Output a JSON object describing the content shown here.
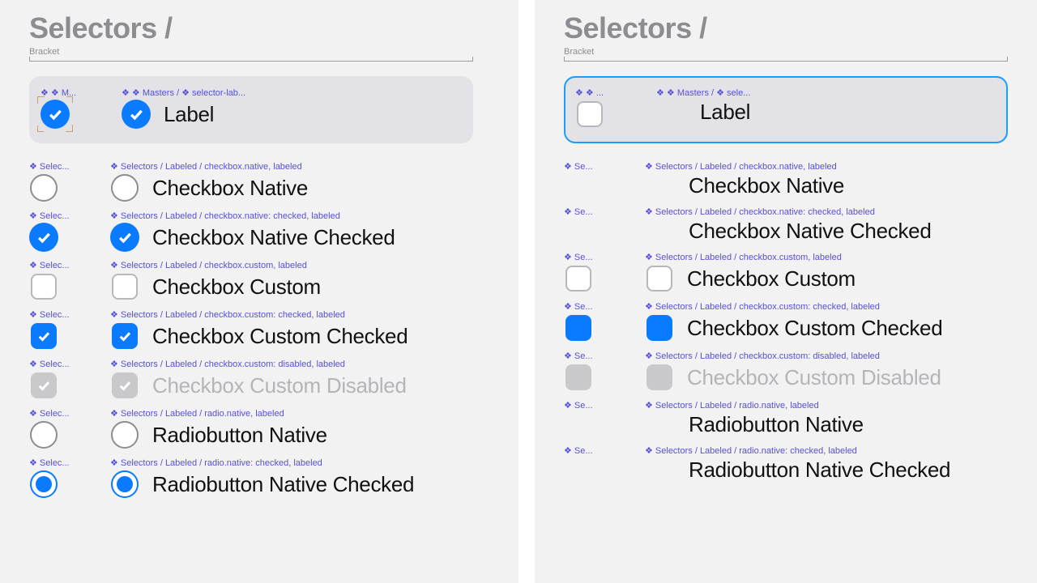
{
  "title": "Selectors /",
  "bracket_label": "Bracket",
  "left": {
    "master": {
      "tag_short": "❖ ❖ M...",
      "tag_long": "❖ ❖ Masters / ❖ selector-lab...",
      "label": "Label"
    },
    "items": [
      {
        "tag_short": "❖ Selec...",
        "tag_long": "❖ Selectors / Labeled / checkbox.native, labeled",
        "label": "Checkbox Native"
      },
      {
        "tag_short": "❖ Selec...",
        "tag_long": "❖ Selectors / Labeled / checkbox.native: checked, labeled",
        "label": "Checkbox Native Checked"
      },
      {
        "tag_short": "❖ Selec...",
        "tag_long": "❖ Selectors / Labeled / checkbox.custom, labeled",
        "label": "Checkbox Custom"
      },
      {
        "tag_short": "❖ Selec...",
        "tag_long": "❖ Selectors / Labeled / checkbox.custom: checked, labeled",
        "label": "Checkbox Custom Checked"
      },
      {
        "tag_short": "❖ Selec...",
        "tag_long": "❖ Selectors / Labeled / checkbox.custom: disabled, labeled",
        "label": "Checkbox Custom Disabled"
      },
      {
        "tag_short": "❖ Selec...",
        "tag_long": "❖ Selectors / Labeled / radio.native, labeled",
        "label": "Radiobutton Native"
      },
      {
        "tag_short": "❖ Selec...",
        "tag_long": "❖ Selectors / Labeled / radio.native: checked, labeled",
        "label": "Radiobutton Native Checked"
      }
    ]
  },
  "right": {
    "master": {
      "tag_short": "❖ ❖ ...",
      "tag_long": "❖ ❖ Masters / ❖ sele...",
      "label": "Label"
    },
    "items": [
      {
        "tag_short": "❖ Se...",
        "tag_long": "❖ Selectors / Labeled / checkbox.native, labeled",
        "label": "Checkbox Native"
      },
      {
        "tag_short": "❖ Se...",
        "tag_long": "❖ Selectors / Labeled / checkbox.native: checked, labeled",
        "label": "Checkbox Native Checked"
      },
      {
        "tag_short": "❖ Se...",
        "tag_long": "❖ Selectors / Labeled / checkbox.custom, labeled",
        "label": "Checkbox Custom"
      },
      {
        "tag_short": "❖ Se...",
        "tag_long": "❖ Selectors / Labeled / checkbox.custom: checked, labeled",
        "label": "Checkbox Custom Checked"
      },
      {
        "tag_short": "❖ Se...",
        "tag_long": "❖ Selectors / Labeled / checkbox.custom: disabled, labeled",
        "label": "Checkbox Custom Disabled"
      },
      {
        "tag_short": "❖ Se...",
        "tag_long": "❖ Selectors / Labeled / radio.native, labeled",
        "label": "Radiobutton Native"
      },
      {
        "tag_short": "❖ Se...",
        "tag_long": "❖ Selectors / Labeled / radio.native: checked, labeled",
        "label": "Radiobutton Native Checked"
      }
    ]
  }
}
